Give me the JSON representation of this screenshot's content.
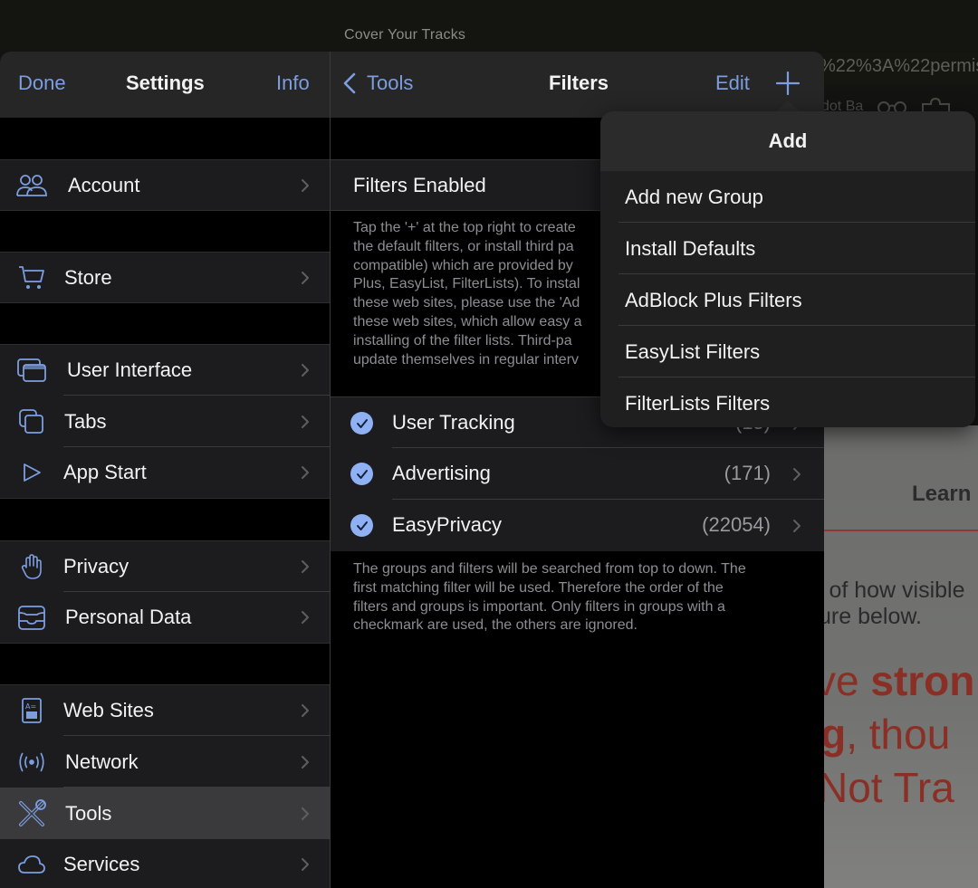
{
  "browser": {
    "page_title": "Cover Your Tracks",
    "url_fragment": "%22%3A%22permis",
    "toolbar_fragment": "dot  Ba",
    "page": {
      "learn_link": "Learn",
      "paragraph_line1": "v of how visible",
      "paragraph_line2": "ure below.",
      "headline_line1_normal": "ve ",
      "headline_line1_bold": "stron",
      "headline_line2_bold": "ng",
      "headline_line2_normal": ", thou",
      "headline_line3": "Not Tra"
    }
  },
  "settings": {
    "nav": {
      "done_label": "Done",
      "title": "Settings",
      "info_label": "Info"
    },
    "groups": [
      [
        {
          "label": "Account",
          "icon": "people-icon"
        }
      ],
      [
        {
          "label": "Store",
          "icon": "cart-icon"
        }
      ],
      [
        {
          "label": "User Interface",
          "icon": "windows-icon"
        },
        {
          "label": "Tabs",
          "icon": "tabs-icon"
        },
        {
          "label": "App Start",
          "icon": "play-icon"
        }
      ],
      [
        {
          "label": "Privacy",
          "icon": "hand-icon"
        },
        {
          "label": "Personal Data",
          "icon": "tray-icon"
        }
      ],
      [
        {
          "label": "Web Sites",
          "icon": "document-icon"
        },
        {
          "label": "Network",
          "icon": "antenna-icon"
        },
        {
          "label": "Tools",
          "icon": "tools-icon",
          "selected": true
        },
        {
          "label": "Services",
          "icon": "cloud-icon"
        }
      ]
    ]
  },
  "filters": {
    "nav": {
      "back_label": "Tools",
      "title": "Filters",
      "edit_label": "Edit",
      "add_icon": "plus-icon"
    },
    "enabled_label": "Filters Enabled",
    "description_lines": [
      "Tap the '+' at the top right to create",
      "the default filters, or install third pa",
      "compatible) which are provided by",
      "Plus, EasyList, FilterLists). To instal",
      "these web sites, please use the 'Ad",
      "these web sites, which allow easy a",
      "installing of the filter lists. Third-pa",
      "update themselves in regular interv"
    ],
    "groups": [
      {
        "name": "User Tracking",
        "count": "(15)",
        "checked": true
      },
      {
        "name": "Advertising",
        "count": "(171)",
        "checked": true
      },
      {
        "name": "EasyPrivacy",
        "count": "(22054)",
        "checked": true
      }
    ],
    "footer_lines": [
      "The groups and filters will be searched from top to down. The",
      "first matching filter will be used. Therefore the order of the",
      "filters and groups is important. Only filters in groups with a",
      "checkmark are used, the others are ignored."
    ]
  },
  "add_menu": {
    "title": "Add",
    "items": [
      "Add new Group",
      "Install Defaults",
      "AdBlock Plus Filters",
      "EasyList Filters",
      "FilterLists Filters"
    ]
  },
  "colors": {
    "accent": "#7c9ee0",
    "check": "#8fb0f2",
    "cell_bg": "#1c1c1e",
    "selected_bg": "#3a3a3c",
    "headline_red": "#8a2f25"
  }
}
